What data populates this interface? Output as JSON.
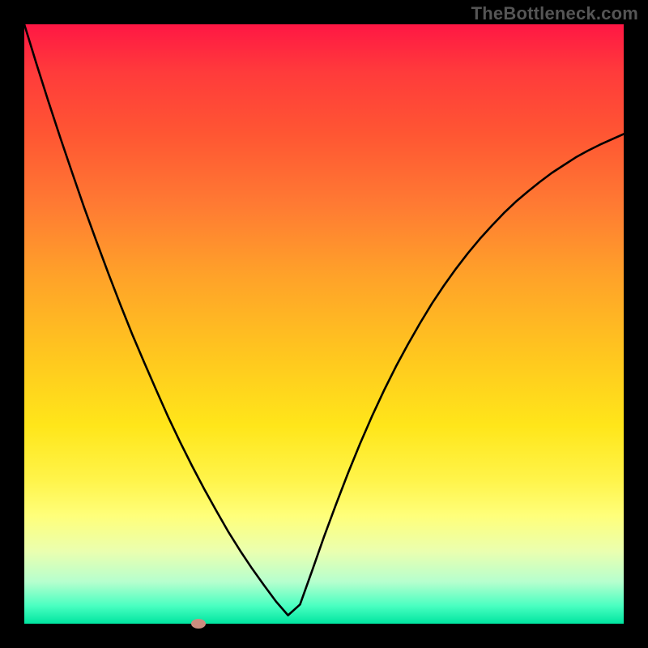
{
  "watermark": "TheBottleneck.com",
  "colors": {
    "frame": "#000000",
    "curve": "#000000",
    "marker": "#cc8d7f",
    "gradient_stops": [
      "#ff1744",
      "#ff3b3b",
      "#ff5533",
      "#ff7a33",
      "#ffa229",
      "#ffc61f",
      "#ffe61a",
      "#fff44a",
      "#ffff7a",
      "#eaffb0",
      "#b6ffce",
      "#4affc1",
      "#00e5a0"
    ]
  },
  "chart_data": {
    "type": "line",
    "title": "",
    "xlabel": "",
    "ylabel": "",
    "xlim": [
      0,
      1
    ],
    "ylim": [
      0,
      1
    ],
    "x": [
      0.0,
      0.02,
      0.04,
      0.06,
      0.08,
      0.1,
      0.12,
      0.14,
      0.16,
      0.18,
      0.2,
      0.22,
      0.24,
      0.26,
      0.28,
      0.3,
      0.32,
      0.34,
      0.36,
      0.38,
      0.4,
      0.42,
      0.44,
      0.46,
      0.48,
      0.5,
      0.52,
      0.54,
      0.56,
      0.58,
      0.6,
      0.62,
      0.64,
      0.66,
      0.68,
      0.7,
      0.72,
      0.74,
      0.76,
      0.78,
      0.8,
      0.82,
      0.84,
      0.86,
      0.88,
      0.9,
      0.92,
      0.94,
      0.96,
      0.98,
      1.0
    ],
    "values": [
      1.0,
      0.935,
      0.872,
      0.811,
      0.752,
      0.694,
      0.639,
      0.585,
      0.533,
      0.483,
      0.436,
      0.39,
      0.345,
      0.303,
      0.263,
      0.225,
      0.189,
      0.154,
      0.122,
      0.092,
      0.064,
      0.037,
      0.014,
      0.032,
      0.088,
      0.145,
      0.199,
      0.251,
      0.3,
      0.346,
      0.389,
      0.429,
      0.466,
      0.501,
      0.534,
      0.564,
      0.592,
      0.618,
      0.642,
      0.664,
      0.685,
      0.704,
      0.721,
      0.737,
      0.752,
      0.765,
      0.778,
      0.789,
      0.799,
      0.808,
      0.817
    ],
    "marker": {
      "x": 0.29,
      "y": 0.0
    },
    "grid": false,
    "legend": false
  }
}
